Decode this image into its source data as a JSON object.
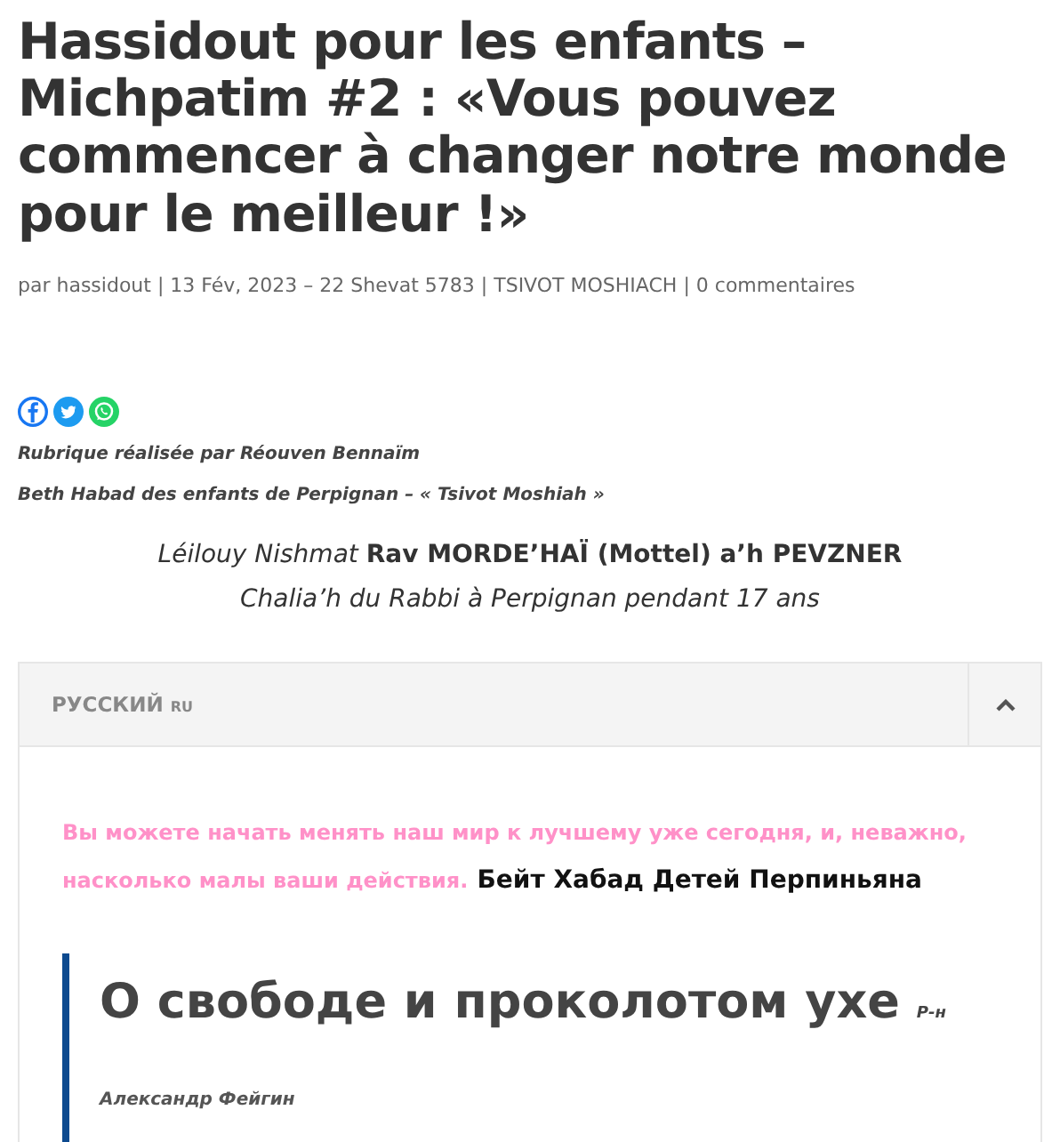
{
  "title": "Hassidout pour les enfants – Michpatim #2 : «Vous pouvez commencer à changer notre monde pour le meilleur !»",
  "meta": "par hassidout | 13 Fév, 2023 – 22 Shevat 5783 | TSIVOT MOSHIACH | 0 commentaires",
  "credits": [
    "Rubrique réalisée par Réouven Bennaïm",
    "Beth Habad des enfants de Perpignan – « Tsivot Moshiah »"
  ],
  "dedication": [
    "*Léilouy Nishmat* **Rav MORDE’HAÏ (Mottel) a’h PEVZNER**",
    "Chalia’h du Rabbi à Perpignan pendant 17 ans"
  ],
  "accordion": {
    "title": "РУССКИЙ",
    "badge": "RU",
    "expanded": true,
    "intro": "Вы можете начать менять наш мир к лучшему уже сегодня, и, неважно, насколько малы ваши действия.",
    "signature": "Бейт Хабад Детей Перпиньяна",
    "article_title": "О свободе и проколотом ухе",
    "article_tag": "Р-н",
    "author": "Александр Фейгин"
  }
}
